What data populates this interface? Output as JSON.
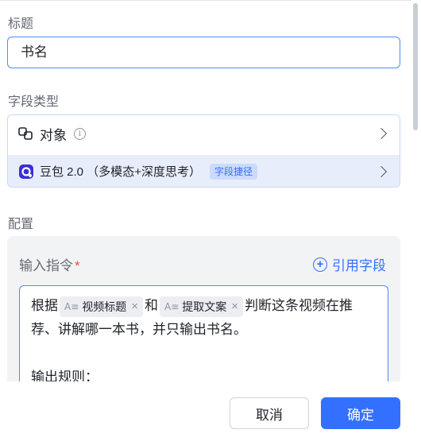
{
  "title_section": {
    "label": "标题",
    "value": "书名"
  },
  "type_section": {
    "label": "字段类型",
    "object_label": "对象",
    "model_name": "豆包 2.0 （多模态+深度思考）",
    "model_tag": "字段捷径"
  },
  "config_section": {
    "label": "配置",
    "command_label": "输入指令",
    "required_mark": "*",
    "ref_button": "引用字段",
    "editor": {
      "prefix": "根据",
      "chip1": "视频标题",
      "middle": "和",
      "chip2": "提取文案",
      "suffix": "判断这条视频在推荐、讲解哪一本书，并只输出书名。",
      "line3": "输出规则："
    }
  },
  "footer": {
    "cancel": "取消",
    "confirm": "确定"
  },
  "colors": {
    "accent": "#3370ff",
    "required": "#f54a45"
  }
}
